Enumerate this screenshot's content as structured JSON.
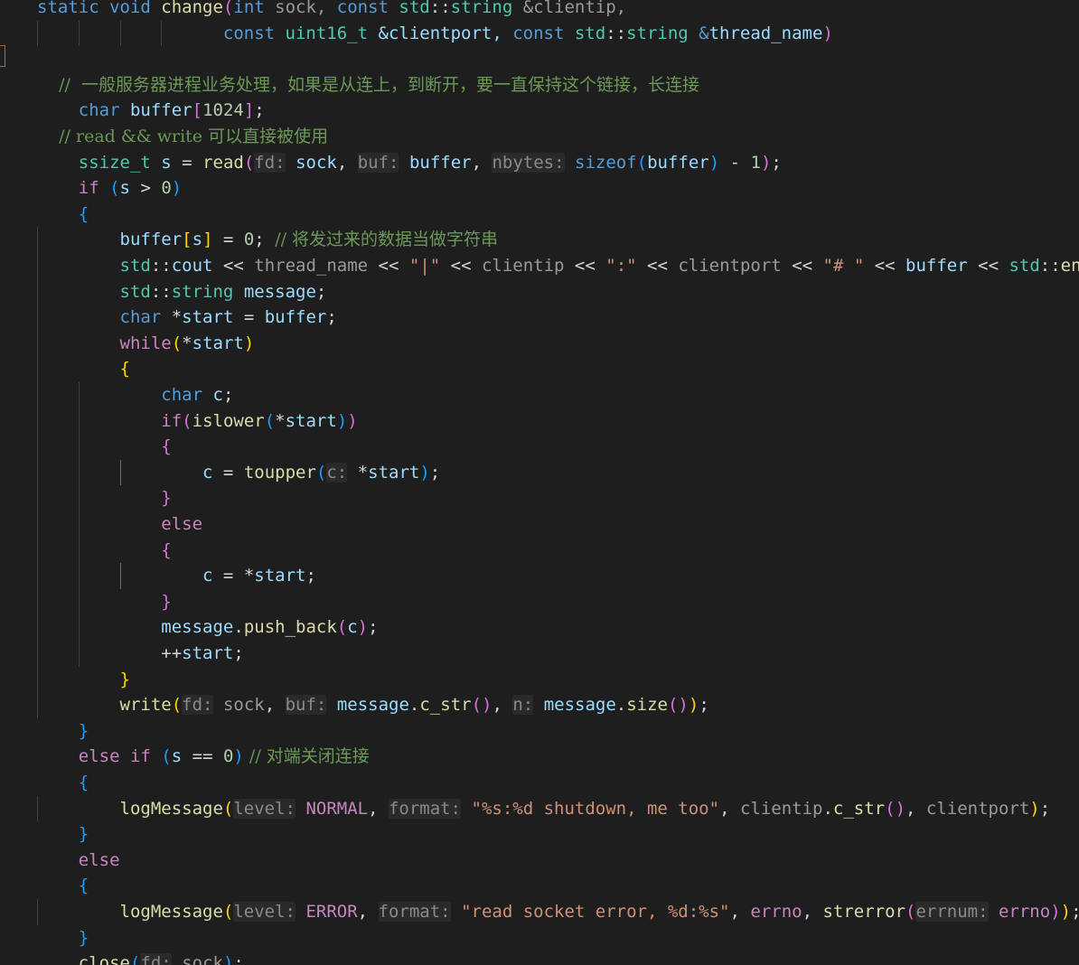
{
  "colors": {
    "background": "#1e1e1e",
    "plain": "#d4d4d4",
    "keyword": "#569cd6",
    "control": "#c586c0",
    "type": "#4ec9b0",
    "function": "#dcdcaa",
    "variable": "#9cdcfe",
    "param_dim": "#9a9a9a",
    "string": "#ce9178",
    "number": "#b5cea8",
    "comment": "#6a9955",
    "constant": "#4fc1ff",
    "hint": "#8a8a8a",
    "bracket1": "#ffd700",
    "bracket2": "#da70d6",
    "bracket3": "#179fff"
  },
  "icons": {
    "gutter_marker": "breakpoint-bracket-icon"
  },
  "lines": [
    [
      [
        "static ",
        "keyword"
      ],
      [
        "void ",
        "keyword"
      ],
      [
        "change",
        "function"
      ],
      [
        "(",
        "bracket2"
      ],
      [
        "int ",
        "keyword"
      ],
      [
        "sock, ",
        "param_dim"
      ],
      [
        "const ",
        "keyword"
      ],
      [
        "std",
        "type"
      ],
      [
        "::",
        "plain"
      ],
      [
        "string ",
        "type"
      ],
      [
        "&clientip,",
        "param_dim"
      ]
    ],
    [
      [
        "                  ",
        "plain"
      ],
      [
        "const ",
        "keyword"
      ],
      [
        "uint16_t ",
        "type"
      ],
      [
        "&clientport, ",
        "variable"
      ],
      [
        "const ",
        "keyword"
      ],
      [
        "std",
        "type"
      ],
      [
        "::",
        "plain"
      ],
      [
        "string ",
        "type"
      ],
      [
        "&",
        "keyword"
      ],
      [
        "thread_name",
        "variable"
      ],
      [
        ")",
        "bracket2"
      ]
    ],
    [
      [
        "",
        "plain"
      ]
    ],
    [
      [
        "    //  一般服务器进程业务处理，如果是从连上，到断开，要一直保持这个链接，长连接",
        "comment"
      ]
    ],
    [
      [
        "    ",
        "plain"
      ],
      [
        "char ",
        "keyword"
      ],
      [
        "buffer",
        "variable"
      ],
      [
        "[",
        "bracket2"
      ],
      [
        "1024",
        "number"
      ],
      [
        "]",
        "bracket2"
      ],
      [
        ";",
        "plain"
      ]
    ],
    [
      [
        "    // read && write 可以直接被使用",
        "comment"
      ]
    ],
    [
      [
        "    ",
        "plain"
      ],
      [
        "ssize_t ",
        "type"
      ],
      [
        "s ",
        "variable"
      ],
      [
        "= ",
        "plain"
      ],
      [
        "read",
        "function"
      ],
      [
        "(",
        "bracket2"
      ],
      [
        "fd:",
        "hint"
      ],
      [
        " ",
        "plain"
      ],
      [
        "sock",
        "variable"
      ],
      [
        ", ",
        "plain"
      ],
      [
        "buf:",
        "hint"
      ],
      [
        " ",
        "plain"
      ],
      [
        "buffer",
        "variable"
      ],
      [
        ", ",
        "plain"
      ],
      [
        "nbytes:",
        "hint"
      ],
      [
        " ",
        "plain"
      ],
      [
        "sizeof",
        "keyword"
      ],
      [
        "(",
        "bracket3"
      ],
      [
        "buffer",
        "variable"
      ],
      [
        ")",
        "bracket3"
      ],
      [
        " - ",
        "plain"
      ],
      [
        "1",
        "number"
      ],
      [
        ")",
        "bracket2"
      ],
      [
        ";",
        "plain"
      ]
    ],
    [
      [
        "    ",
        "plain"
      ],
      [
        "if ",
        "control"
      ],
      [
        "(",
        "bracket3"
      ],
      [
        "s ",
        "variable"
      ],
      [
        "> ",
        "plain"
      ],
      [
        "0",
        "number"
      ],
      [
        ")",
        "bracket3"
      ]
    ],
    [
      [
        "    ",
        "plain"
      ],
      [
        "{",
        "bracket3"
      ]
    ],
    [
      [
        "        ",
        "plain"
      ],
      [
        "buffer",
        "variable"
      ],
      [
        "[",
        "bracket1"
      ],
      [
        "s",
        "variable"
      ],
      [
        "]",
        "bracket1"
      ],
      [
        " = ",
        "plain"
      ],
      [
        "0",
        "number"
      ],
      [
        "; ",
        "plain"
      ],
      [
        "// 将发过来的数据当做字符串",
        "comment"
      ]
    ],
    [
      [
        "        ",
        "plain"
      ],
      [
        "std",
        "type"
      ],
      [
        "::",
        "plain"
      ],
      [
        "cout ",
        "variable"
      ],
      [
        "<< ",
        "plain"
      ],
      [
        "thread_name ",
        "param_dim"
      ],
      [
        "<< ",
        "plain"
      ],
      [
        "\"|\" ",
        "string"
      ],
      [
        "<< ",
        "plain"
      ],
      [
        "clientip ",
        "param_dim"
      ],
      [
        "<< ",
        "plain"
      ],
      [
        "\":\" ",
        "string"
      ],
      [
        "<< ",
        "plain"
      ],
      [
        "clientport ",
        "param_dim"
      ],
      [
        "<< ",
        "plain"
      ],
      [
        "\"# \" ",
        "string"
      ],
      [
        "<< ",
        "plain"
      ],
      [
        "buffer ",
        "variable"
      ],
      [
        "<< ",
        "plain"
      ],
      [
        "std",
        "type"
      ],
      [
        "::",
        "plain"
      ],
      [
        "endl",
        "function"
      ],
      [
        ";",
        "plain"
      ]
    ],
    [
      [
        "        ",
        "plain"
      ],
      [
        "std",
        "type"
      ],
      [
        "::",
        "plain"
      ],
      [
        "string ",
        "type"
      ],
      [
        "message",
        "variable"
      ],
      [
        ";",
        "plain"
      ]
    ],
    [
      [
        "        ",
        "plain"
      ],
      [
        "char ",
        "keyword"
      ],
      [
        "*",
        "plain"
      ],
      [
        "start ",
        "variable"
      ],
      [
        "= ",
        "plain"
      ],
      [
        "buffer",
        "variable"
      ],
      [
        ";",
        "plain"
      ]
    ],
    [
      [
        "        ",
        "plain"
      ],
      [
        "while",
        "control"
      ],
      [
        "(",
        "bracket1"
      ],
      [
        "*",
        "plain"
      ],
      [
        "start",
        "variable"
      ],
      [
        ")",
        "bracket1"
      ]
    ],
    [
      [
        "        ",
        "plain"
      ],
      [
        "{",
        "bracket1"
      ]
    ],
    [
      [
        "            ",
        "plain"
      ],
      [
        "char ",
        "keyword"
      ],
      [
        "c",
        "variable"
      ],
      [
        ";",
        "plain"
      ]
    ],
    [
      [
        "            ",
        "plain"
      ],
      [
        "if",
        "control"
      ],
      [
        "(",
        "bracket2"
      ],
      [
        "islower",
        "function"
      ],
      [
        "(",
        "bracket3"
      ],
      [
        "*",
        "plain"
      ],
      [
        "start",
        "variable"
      ],
      [
        ")",
        "bracket3"
      ],
      [
        ")",
        "bracket2"
      ]
    ],
    [
      [
        "            ",
        "plain"
      ],
      [
        "{",
        "bracket2"
      ]
    ],
    [
      [
        "                ",
        "plain"
      ],
      [
        "c ",
        "variable"
      ],
      [
        "= ",
        "plain"
      ],
      [
        "toupper",
        "function"
      ],
      [
        "(",
        "bracket3"
      ],
      [
        "c:",
        "hint"
      ],
      [
        " ",
        "plain"
      ],
      [
        "*",
        "plain"
      ],
      [
        "start",
        "variable"
      ],
      [
        ")",
        "bracket3"
      ],
      [
        ";",
        "plain"
      ]
    ],
    [
      [
        "            ",
        "plain"
      ],
      [
        "}",
        "bracket2"
      ]
    ],
    [
      [
        "            ",
        "plain"
      ],
      [
        "else",
        "control"
      ]
    ],
    [
      [
        "            ",
        "plain"
      ],
      [
        "{",
        "bracket2"
      ]
    ],
    [
      [
        "                ",
        "plain"
      ],
      [
        "c ",
        "variable"
      ],
      [
        "= ",
        "plain"
      ],
      [
        "*",
        "plain"
      ],
      [
        "start",
        "variable"
      ],
      [
        ";",
        "plain"
      ]
    ],
    [
      [
        "            ",
        "plain"
      ],
      [
        "}",
        "bracket2"
      ]
    ],
    [
      [
        "            ",
        "plain"
      ],
      [
        "message",
        "variable"
      ],
      [
        ".",
        "plain"
      ],
      [
        "push_back",
        "function"
      ],
      [
        "(",
        "bracket2"
      ],
      [
        "c",
        "variable"
      ],
      [
        ")",
        "bracket2"
      ],
      [
        ";",
        "plain"
      ]
    ],
    [
      [
        "            ",
        "plain"
      ],
      [
        "++",
        "plain"
      ],
      [
        "start",
        "variable"
      ],
      [
        ";",
        "plain"
      ]
    ],
    [
      [
        "        ",
        "plain"
      ],
      [
        "}",
        "bracket1"
      ]
    ],
    [
      [
        "        ",
        "plain"
      ],
      [
        "write",
        "function"
      ],
      [
        "(",
        "bracket1"
      ],
      [
        "fd:",
        "hint"
      ],
      [
        " ",
        "plain"
      ],
      [
        "sock",
        "param_dim"
      ],
      [
        ", ",
        "plain"
      ],
      [
        "buf:",
        "hint"
      ],
      [
        " ",
        "plain"
      ],
      [
        "message",
        "variable"
      ],
      [
        ".",
        "plain"
      ],
      [
        "c_str",
        "function"
      ],
      [
        "()",
        "bracket2"
      ],
      [
        ", ",
        "plain"
      ],
      [
        "n:",
        "hint"
      ],
      [
        " ",
        "plain"
      ],
      [
        "message",
        "variable"
      ],
      [
        ".",
        "plain"
      ],
      [
        "size",
        "function"
      ],
      [
        "()",
        "bracket2"
      ],
      [
        ")",
        "bracket1"
      ],
      [
        ";",
        "plain"
      ]
    ],
    [
      [
        "    ",
        "plain"
      ],
      [
        "}",
        "bracket3"
      ]
    ],
    [
      [
        "    ",
        "plain"
      ],
      [
        "else ",
        "control"
      ],
      [
        "if ",
        "control"
      ],
      [
        "(",
        "bracket3"
      ],
      [
        "s ",
        "variable"
      ],
      [
        "== ",
        "plain"
      ],
      [
        "0",
        "number"
      ],
      [
        ")",
        "bracket3"
      ],
      [
        " // 对端关闭连接",
        "comment"
      ]
    ],
    [
      [
        "    ",
        "plain"
      ],
      [
        "{",
        "bracket3"
      ]
    ],
    [
      [
        "        ",
        "plain"
      ],
      [
        "logMessage",
        "function"
      ],
      [
        "(",
        "bracket1"
      ],
      [
        "level:",
        "hint"
      ],
      [
        " ",
        "plain"
      ],
      [
        "NORMAL",
        "control"
      ],
      [
        ", ",
        "plain"
      ],
      [
        "format:",
        "hint"
      ],
      [
        " ",
        "plain"
      ],
      [
        "\"%s:%d shutdown, me too\"",
        "string"
      ],
      [
        ", ",
        "plain"
      ],
      [
        "clientip",
        "param_dim"
      ],
      [
        ".",
        "plain"
      ],
      [
        "c_str",
        "function"
      ],
      [
        "()",
        "bracket2"
      ],
      [
        ", ",
        "plain"
      ],
      [
        "clientport",
        "param_dim"
      ],
      [
        ")",
        "bracket1"
      ],
      [
        ";",
        "plain"
      ]
    ],
    [
      [
        "    ",
        "plain"
      ],
      [
        "}",
        "bracket3"
      ]
    ],
    [
      [
        "    ",
        "plain"
      ],
      [
        "else",
        "control"
      ]
    ],
    [
      [
        "    ",
        "plain"
      ],
      [
        "{",
        "bracket3"
      ]
    ],
    [
      [
        "        ",
        "plain"
      ],
      [
        "logMessage",
        "function"
      ],
      [
        "(",
        "bracket1"
      ],
      [
        "level:",
        "hint"
      ],
      [
        " ",
        "plain"
      ],
      [
        "ERROR",
        "control"
      ],
      [
        ", ",
        "plain"
      ],
      [
        "format:",
        "hint"
      ],
      [
        " ",
        "plain"
      ],
      [
        "\"read socket error, %d:%s\"",
        "string"
      ],
      [
        ", ",
        "plain"
      ],
      [
        "errno",
        "control"
      ],
      [
        ", ",
        "plain"
      ],
      [
        "strerror",
        "function"
      ],
      [
        "(",
        "bracket2"
      ],
      [
        "errnum:",
        "hint"
      ],
      [
        " ",
        "plain"
      ],
      [
        "errno",
        "control"
      ],
      [
        ")",
        "bracket2"
      ],
      [
        ")",
        "bracket1"
      ],
      [
        ";",
        "plain"
      ]
    ],
    [
      [
        "    ",
        "plain"
      ],
      [
        "}",
        "bracket3"
      ]
    ],
    [
      [
        "    ",
        "plain"
      ],
      [
        "close",
        "function"
      ],
      [
        "(",
        "bracket3"
      ],
      [
        "fd:",
        "hint"
      ],
      [
        " ",
        "plain"
      ],
      [
        "sock",
        "param_dim"
      ],
      [
        ")",
        "bracket3"
      ],
      [
        ";",
        "plain"
      ]
    ]
  ]
}
